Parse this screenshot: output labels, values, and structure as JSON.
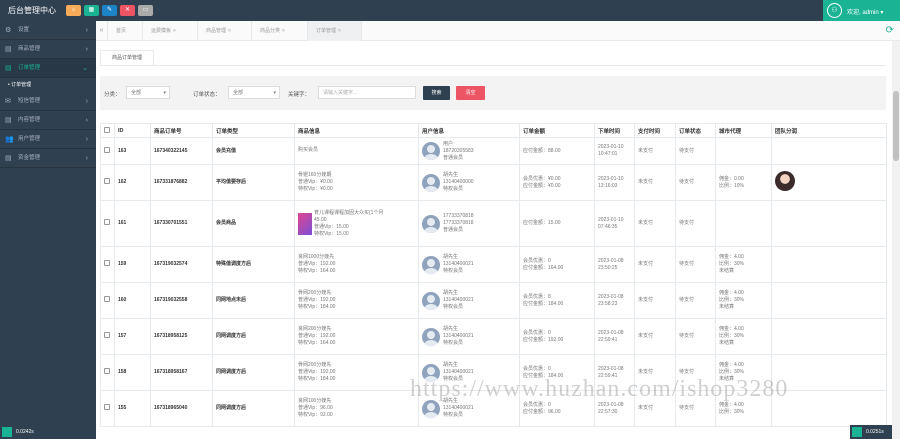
{
  "app": {
    "title": "后台管理中心"
  },
  "toolbar": {
    "buttons": [
      {
        "icon": "home-icon",
        "glyph": "⌂",
        "color": "#f8ac59"
      },
      {
        "icon": "grid-icon",
        "glyph": "▦",
        "color": "#1ab394"
      },
      {
        "icon": "edit-icon",
        "glyph": "✎",
        "color": "#1c84c6"
      },
      {
        "icon": "trash-icon",
        "glyph": "✕",
        "color": "#ed5565"
      },
      {
        "icon": "window-icon",
        "glyph": "▭",
        "color": "#aaaaaa"
      }
    ]
  },
  "user": {
    "name": "欢迎, admin ▾",
    "avatar_glyph": "⚇"
  },
  "sidebar": {
    "items": [
      {
        "label": "设置",
        "icon": "⚙",
        "arrow": "›"
      },
      {
        "label": "商品管理",
        "icon": "▤",
        "arrow": "›"
      },
      {
        "label": "订单管理",
        "icon": "▤",
        "arrow": "⌄",
        "active": true
      },
      {
        "label": "短信管理",
        "icon": "✉",
        "arrow": "›"
      },
      {
        "label": "内容管理",
        "icon": "▤",
        "arrow": "›"
      },
      {
        "label": "用户管理",
        "icon": "👥",
        "arrow": "›"
      },
      {
        "label": "资金管理",
        "icon": "▤",
        "arrow": "›"
      }
    ],
    "subitem": "• 订单管理"
  },
  "tabs": {
    "items": [
      "首页",
      "运费模板",
      "商品管理",
      "商品分类",
      "订单管理"
    ],
    "refresh_glyph": "⟳"
  },
  "content": {
    "subtab": "商品订单管理",
    "filter": {
      "category_label": "分类：",
      "category_value": "全部",
      "status_label": "订单状态：",
      "status_value": "全部",
      "keyword_label": "关键字：",
      "keyword_placeholder": "请输入关键字...",
      "search_label": "搜索",
      "reset_label": "清空",
      "search_color": "#2f4050",
      "reset_color": "#ed5565"
    },
    "columns": [
      "",
      "ID",
      "商品订单号",
      "订单类型",
      "商品信息",
      "用户信息",
      "订单金额",
      "下单时间",
      "支付时间",
      "订单状态",
      "城市代理",
      "团队分润"
    ],
    "rows": [
      {
        "id": "163",
        "order": "167340322145",
        "type": "会员充值",
        "product": [
          "购买会员"
        ],
        "user": [
          "用户",
          "18720305583",
          "普通会员"
        ],
        "amount": [
          "应付金额：88.00"
        ],
        "time": [
          "2023-01-10",
          "10:47:01"
        ],
        "pay": "未支付",
        "status": "待支付",
        "city": [],
        "team": false
      },
      {
        "id": "162",
        "order": "167331876882",
        "type": "平均值要存后",
        "product": [
          "骨镫160分娩期",
          "普通Vip：¥0.00",
          "特权Vip：¥0.00"
        ],
        "user": [
          "胡先生",
          "13140400000",
          "特权会员"
        ],
        "amount": [
          "会员优惠：¥0.00",
          "应付金额：¥0.00"
        ],
        "time": [
          "2023-01-10",
          "13:16:03"
        ],
        "pay": "未支付",
        "status": "待支付",
        "city": [
          "佣金：0.00",
          "比例：10%"
        ],
        "team": true
      },
      {
        "id": "161",
        "order": "167330701551",
        "type": "会员商品",
        "product": [
          "育儿课程课程加固大众买(1个月",
          "45.00",
          "普通Vip：15.00",
          "特权Vip：15.00"
        ],
        "user": [
          "17733370818",
          "17733370818",
          "普通会员"
        ],
        "amount": [
          "应付金额：15.00"
        ],
        "time": [
          "2023-01-10",
          "07:46:35"
        ],
        "pay": "未支付",
        "status": "待支付",
        "city": [],
        "team": false,
        "thumb": true
      },
      {
        "id": "159",
        "order": "167319032574",
        "type": "特殊值调度方后",
        "product": [
          "良网1000分娩先",
          "普通Vip：192.00",
          "特权Vip：164.00"
        ],
        "user": [
          "胡先生",
          "13140400021",
          "特权会员"
        ],
        "amount": [
          "会员优惠：0",
          "应付金额：164.00"
        ],
        "time": [
          "2023-01-08",
          "23:50:25"
        ],
        "pay": "未支付",
        "status": "待支付",
        "city": [
          "佣金：4.00",
          "比例：30%",
          "未结算"
        ],
        "team": false
      },
      {
        "id": "160",
        "order": "167319032558",
        "type": "同网地点未后",
        "product": [
          "骨网200分娩先",
          "普通Vip：192.00",
          "特权Vip：184.00"
        ],
        "user": [
          "胡先生",
          "13140400021",
          "特权会员"
        ],
        "amount": [
          "会员优惠：8",
          "应付金额：184.00"
        ],
        "time": [
          "2023-01-08",
          "23:58:23"
        ],
        "pay": "未支付",
        "status": "待支付",
        "city": [
          "佣金：4.00",
          "比例：30%",
          "未结算"
        ],
        "team": false
      },
      {
        "id": "157",
        "order": "167318958125",
        "type": "同网调度方后",
        "product": [
          "良网200分娩先",
          "普通Vip：192.00",
          "特权Vip：164.00"
        ],
        "user": [
          "胡先生",
          "13140400021",
          "特权会员"
        ],
        "amount": [
          "会员优惠：0",
          "应付金额：192.00"
        ],
        "time": [
          "2023-01-08",
          "22:59:41"
        ],
        "pay": "未支付",
        "status": "待支付",
        "city": [
          "佣金：4.00",
          "比例：30%",
          "未结算"
        ],
        "team": false
      },
      {
        "id": "158",
        "order": "167318958167",
        "type": "同网调度方后",
        "product": [
          "骨网200分娩先",
          "普通Vip：192.00",
          "特权Vip：184.00"
        ],
        "user": [
          "胡先生",
          "13140400021",
          "特权会员"
        ],
        "amount": [
          "会员优惠：0",
          "应付金额：184.00"
        ],
        "time": [
          "2023-01-08",
          "22:59:41"
        ],
        "pay": "未支付",
        "status": "待支付",
        "city": [
          "佣金：4.00",
          "比例：30%",
          "未结算"
        ],
        "team": false
      },
      {
        "id": "155",
        "order": "167318965040",
        "type": "同网调度方后",
        "product": [
          "良网100分娩先",
          "普通Vip：96.00",
          "特权Vip：92.00"
        ],
        "user": [
          "胡先生",
          "13140400021",
          "特权会员"
        ],
        "amount": [
          "会员优惠：0",
          "应付金额：96.00"
        ],
        "time": [
          "2023-01-08",
          "22:57:30"
        ],
        "pay": "未支付",
        "status": "待支付",
        "city": [
          "佣金：4.00",
          "比例：30%"
        ],
        "team": false
      }
    ]
  },
  "watermark": "https://www.huzhan.com/ishop3280",
  "perf": {
    "left": "0.0242s",
    "right": "0.0251s"
  }
}
